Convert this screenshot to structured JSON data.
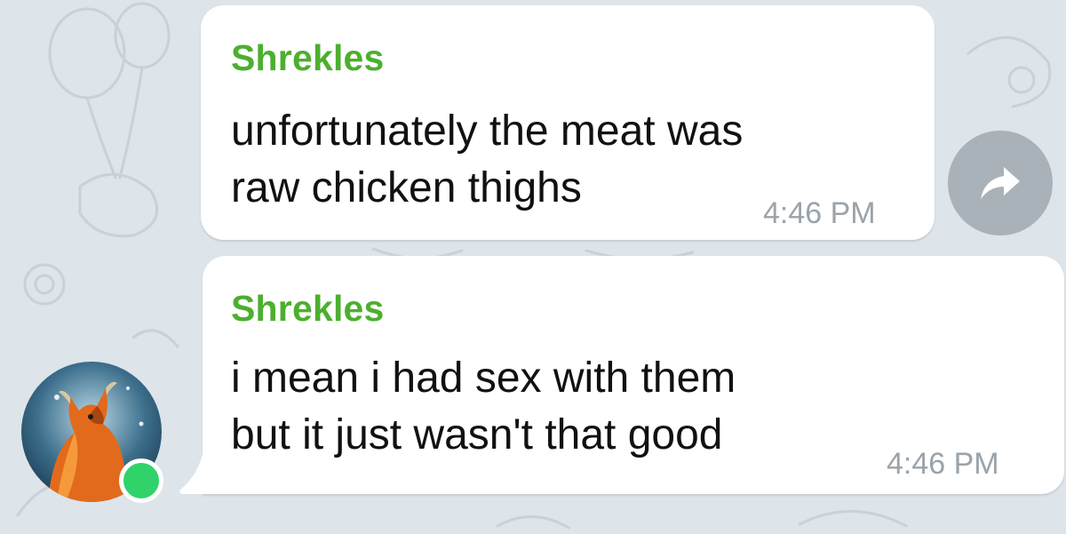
{
  "messages": [
    {
      "sender": "Shrekles",
      "lines": [
        "unfortunately the meat was",
        "raw chicken thighs"
      ],
      "time": "4:46 PM"
    },
    {
      "sender": "Shrekles",
      "lines": [
        "i mean i had sex with them",
        "but it just wasn't that good"
      ],
      "time": "4:46 PM"
    }
  ],
  "icons": {
    "forward": "forward-arrow-icon",
    "online": "online-status-dot"
  },
  "colors": {
    "background": "#dde4ea",
    "bubble": "#ffffff",
    "sender_name": "#4caf2e",
    "timestamp": "#9aa3ab",
    "forward_button": "#a9b2b9",
    "online_dot": "#2fd36a"
  }
}
